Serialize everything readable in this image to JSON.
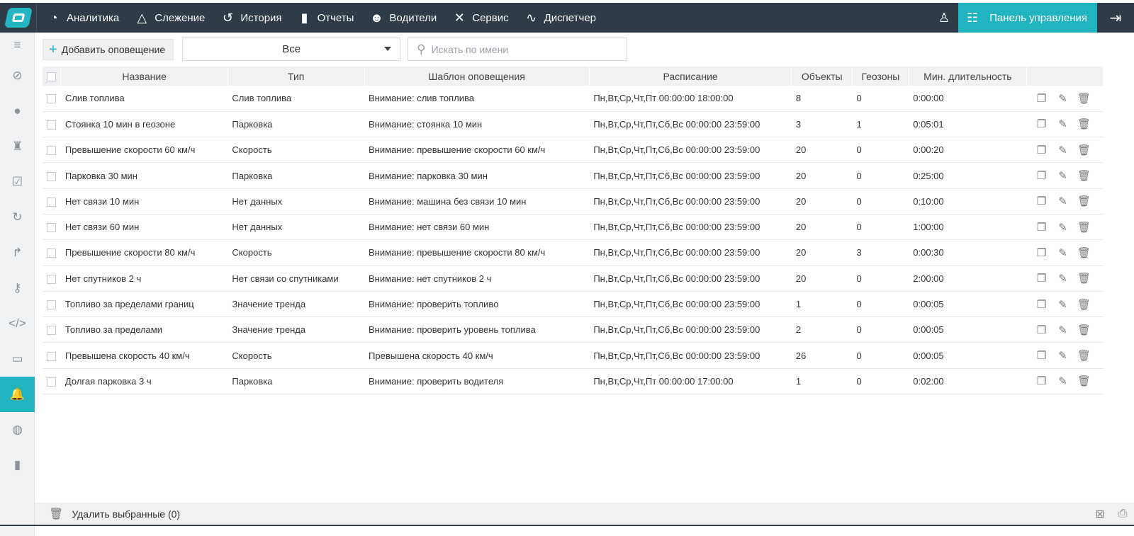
{
  "nav": {
    "items": [
      {
        "label": "Аналитика",
        "icon": "analytics-icon"
      },
      {
        "label": "Слежение",
        "icon": "tracking-icon"
      },
      {
        "label": "История",
        "icon": "history-icon"
      },
      {
        "label": "Отчеты",
        "icon": "reports-icon"
      },
      {
        "label": "Водители",
        "icon": "drivers-icon"
      },
      {
        "label": "Сервис",
        "icon": "service-icon"
      },
      {
        "label": "Диспетчер",
        "icon": "dispatcher-icon"
      }
    ],
    "panel_label": "Панель управления"
  },
  "toolbar": {
    "add_label": "Добавить оповещение",
    "filter_value": "Все",
    "search_placeholder": "Искать по имени"
  },
  "table": {
    "headers": [
      "Название",
      "Тип",
      "Шаблон оповещения",
      "Расписание",
      "Объекты",
      "Геозоны",
      "Мин. длительность"
    ],
    "rows": [
      [
        "Слив топлива",
        "Слив топлива",
        "Внимание: слив топлива",
        "Пн,Вт,Ср,Чт,Пт 00:00:00 18:00:00",
        "8",
        "0",
        "0:00:00"
      ],
      [
        "Стоянка 10 мин в геозоне",
        "Парковка",
        "Внимание: стоянка 10 мин",
        "Пн,Вт,Ср,Чт,Пт,Сб,Вс 00:00:00 23:59:00",
        "3",
        "1",
        "0:05:01"
      ],
      [
        "Превышение скорости 60 км/ч",
        "Скорость",
        "Внимание: превышение скорости 60 км/ч",
        "Пн,Вт,Ср,Чт,Пт,Сб,Вс 00:00:00 23:59:00",
        "20",
        "0",
        "0:00:20"
      ],
      [
        "Парковка 30 мин",
        "Парковка",
        "Внимание: парковка 30 мин",
        "Пн,Вт,Ср,Чт,Пт,Сб,Вс 00:00:00 23:59:00",
        "20",
        "0",
        "0:25:00"
      ],
      [
        "Нет связи 10 мин",
        "Нет данных",
        "Внимание: машина без связи 10 мин",
        "Пн,Вт,Ср,Чт,Пт,Сб,Вс 00:00:00 23:59:00",
        "20",
        "0",
        "0:10:00"
      ],
      [
        "Нет связи 60 мин",
        "Нет данных",
        "Внимание: нет связи 60 мин",
        "Пн,Вт,Ср,Чт,Пт,Сб,Вс 00:00:00 23:59:00",
        "20",
        "0",
        "1:00:00"
      ],
      [
        "Превышение скорости 80 км/ч",
        "Скорость",
        "Внимание: превышение скорости 80 км/ч",
        "Пн,Вт,Ср,Чт,Пт,Сб,Вс 00:00:00 23:59:00",
        "20",
        "3",
        "0:00:30"
      ],
      [
        "Нет спутников 2 ч",
        "Нет связи со спутниками",
        "Внимание: нет спутников 2 ч",
        "Пн,Вт,Ср,Чт,Пт,Сб,Вс 00:00:00 23:59:00",
        "20",
        "0",
        "2:00:00"
      ],
      [
        "Топливо за пределами границ",
        "Значение тренда",
        "Внимание: проверить топливо",
        "Пн,Вт,Ср,Чт,Пт,Сб,Вс 00:00:00 23:59:00",
        "1",
        "0",
        "0:00:05"
      ],
      [
        "Топливо за пределами",
        "Значение тренда",
        "Внимание: проверить уровень топлива",
        "Пн,Вт,Ср,Чт,Пт,Сб,Вс 00:00:00 23:59:00",
        "2",
        "0",
        "0:00:05"
      ],
      [
        "Превышена скорость 40 км/ч",
        "Скорость",
        "Превышена скорость 40 км/ч",
        "Пн,Вт,Ср,Чт,Пт,Сб,Вс 00:00:00 23:59:00",
        "26",
        "0",
        "0:00:05"
      ],
      [
        "Долгая парковка 3 ч",
        "Парковка",
        "Внимание: проверить водителя",
        "Пн,Вт,Ср,Чт,Пт 00:00:00 17:00:00",
        "1",
        "0",
        "0:02:00"
      ]
    ]
  },
  "footer": {
    "delete_label": "Удалить выбранные (0)"
  },
  "colors": {
    "topbar": "#2f3b47",
    "accent": "#1fb4bf"
  }
}
